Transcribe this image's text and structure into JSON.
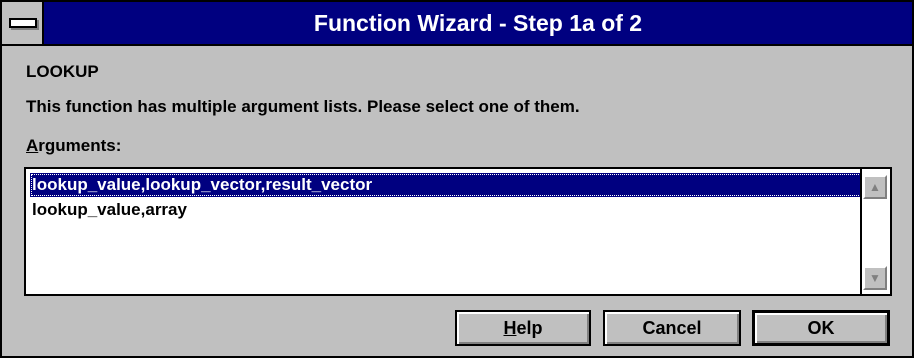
{
  "window": {
    "title": "Function Wizard - Step 1a of 2"
  },
  "function_name": "LOOKUP",
  "description": "This function has multiple argument lists.  Please select one of them.",
  "arguments": {
    "label_first": "A",
    "label_rest": "rguments:",
    "items": [
      {
        "label": "lookup_value,lookup_vector,result_vector",
        "selected": true
      },
      {
        "label": "lookup_value,array",
        "selected": false
      }
    ]
  },
  "buttons": {
    "help_first": "H",
    "help_rest": "elp",
    "cancel": "Cancel",
    "ok": "OK"
  },
  "icons": {
    "system_menu": "system-menu-icon",
    "scroll_up": "scroll-up-arrow-icon",
    "scroll_down": "scroll-down-arrow-icon"
  },
  "colors": {
    "titlebar": "#000080",
    "face": "#c0c0c0",
    "selection": "#000080"
  }
}
